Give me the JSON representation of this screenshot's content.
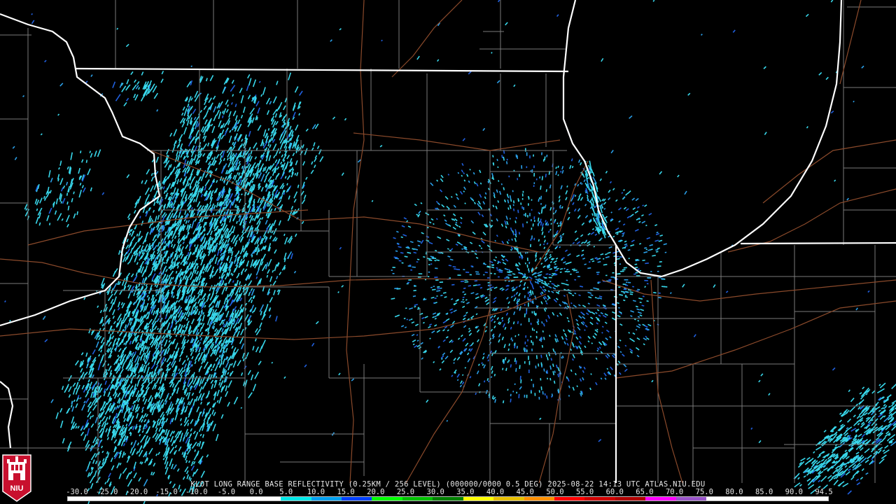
{
  "title": {
    "product": "KLOT LONG RANGE BASE REFLECTIVITY",
    "resolution": "(0.25KM / 256 LEVEL)",
    "scan": "(000000/0000 0.5 DEG)",
    "date": "2025-08-22",
    "time": "14:13 UTC",
    "source": "ATLAS.NIU.EDU"
  },
  "logo": {
    "text": "NIU",
    "icon": "niu-castle-logo-icon",
    "color": "#c8102e"
  },
  "legend": {
    "ticks": [
      "-30.0",
      "-25.0",
      "-20.0",
      "-15.0",
      "-10.0",
      "-5.0",
      "0.0",
      "5.0",
      "10.0",
      "15.0",
      "20.0",
      "25.0",
      "30.0",
      "35.0",
      "40.0",
      "45.0",
      "50.0",
      "55.0",
      "60.0",
      "65.0",
      "70.0",
      "75.0",
      "80.0",
      "85.0",
      "90.0",
      "94.5"
    ],
    "colors": [
      "#ffffff",
      "#ffffff",
      "#ffffff",
      "#ffffff",
      "#ffffff",
      "#ffffff",
      "#ffffff",
      "#00e8e8",
      "#00a0f0",
      "#0040ff",
      "#00ff00",
      "#00c000",
      "#008000",
      "#ffff00",
      "#e8c000",
      "#ff9000",
      "#ff0000",
      "#d00000",
      "#b00000",
      "#ff00ff",
      "#9955c9",
      "#ffffff",
      "#ffffff",
      "#ffffff",
      "#ffffff"
    ]
  },
  "colors": {
    "state_border": "#ffffff",
    "county_border": "#7a7a7a",
    "highway": "#8b4a2b",
    "echo_light": "#38d8ec",
    "echo_mid": "#2a9fe8",
    "echo_dark": "#2060e0"
  }
}
